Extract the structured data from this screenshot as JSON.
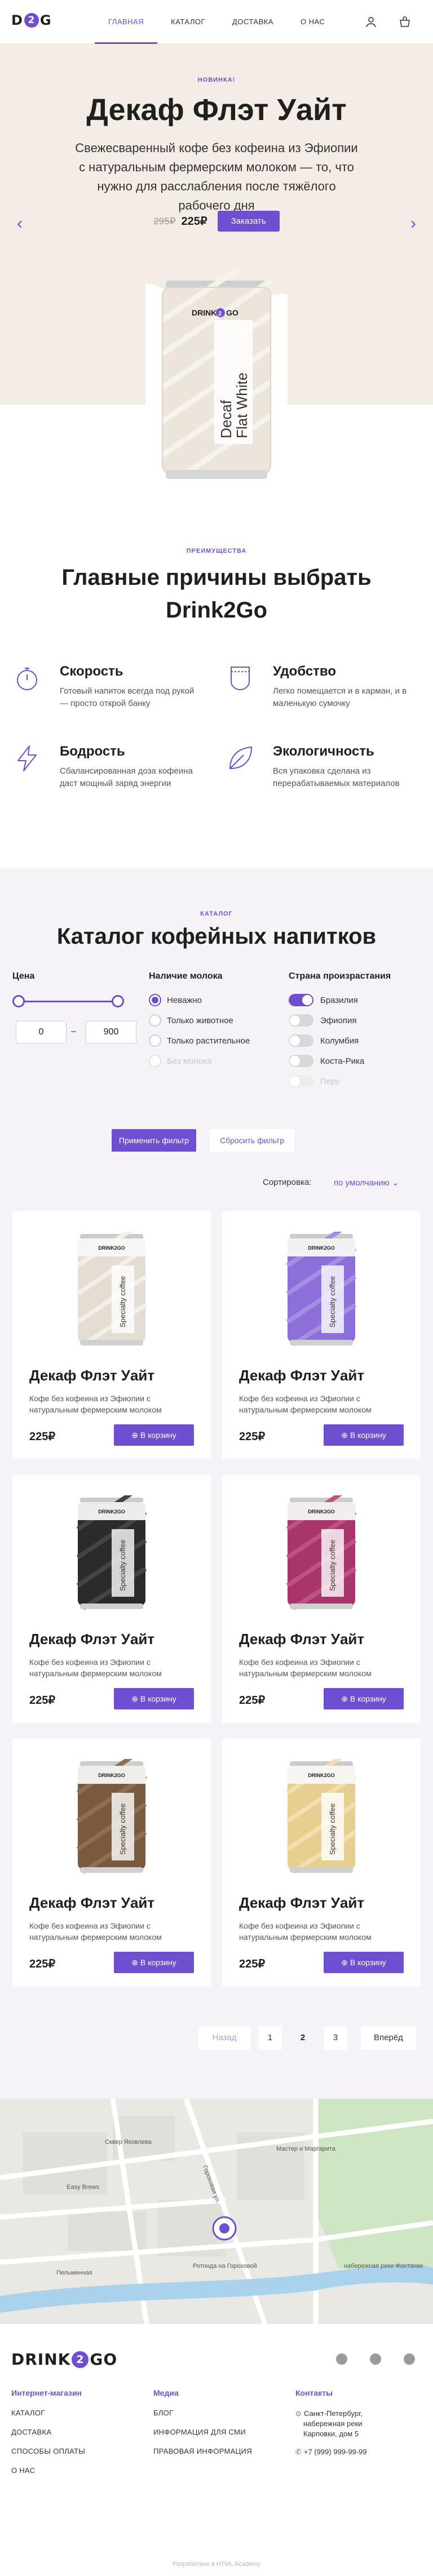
{
  "header": {
    "logo_left": "D",
    "logo_mid": "2",
    "logo_right": "G",
    "nav": [
      "ГЛАВНАЯ",
      "КАТАЛОГ",
      "ДОСТАВКА",
      "О НАС"
    ],
    "icons": [
      "user-icon",
      "cart-icon"
    ]
  },
  "hero": {
    "badge": "НОВИНКА!",
    "title": "Декаф Флэт Уайт",
    "description": "Свежесваренный кофе без кофеина из Эфиопии с натуральным фермерским молоком — то, что нужно для расслабления после тяжёлого рабочего дня",
    "old_price": "295₽",
    "new_price": "225₽",
    "order_label": "Заказать",
    "can_brand": "DRINK",
    "can_brand_2": "2",
    "can_brand_3": "GO",
    "can_text_1": "Decaf",
    "can_text_2": "Flat White"
  },
  "features": {
    "badge": "ПРЕИМУЩЕСТВА",
    "title_line1": "Главные причины выбрать",
    "title_line2": "Drink2Go",
    "items": [
      {
        "title": "Скорость",
        "text": "Готовый напиток всегда под рукой — просто открой банку",
        "icon": "stopwatch-icon"
      },
      {
        "title": "Удобство",
        "text": "Легко помещается и в карман, и в маленькую сумочку",
        "icon": "pocket-icon"
      },
      {
        "title": "Бодрость",
        "text": "Сбалансированная доза кофеина даст мощный заряд энергии",
        "icon": "lightning-icon"
      },
      {
        "title": "Экологичность",
        "text": "Вся упаковка сделана из перерабатываемых материалов",
        "icon": "leaf-icon"
      }
    ]
  },
  "catalog": {
    "badge": "КАТАЛОГ",
    "title": "Каталог кофейных напитков",
    "filters": {
      "price_title": "Цена",
      "price_min": "0",
      "price_max": "900",
      "price_range": [
        0,
        900
      ],
      "milk_title": "Наличие молока",
      "milk_options": [
        {
          "label": "Неважно",
          "checked": true,
          "disabled": false
        },
        {
          "label": "Только животное",
          "checked": false,
          "disabled": false
        },
        {
          "label": "Только растительное",
          "checked": false,
          "disabled": false
        },
        {
          "label": "Без молока",
          "checked": false,
          "disabled": true
        }
      ],
      "country_title": "Страна произрастания",
      "country_options": [
        {
          "label": "Бразилия",
          "on": true,
          "disabled": false
        },
        {
          "label": "Эфиопия",
          "on": false,
          "disabled": false
        },
        {
          "label": "Колумбия",
          "on": false,
          "disabled": false
        },
        {
          "label": "Коста-Рика",
          "on": false,
          "disabled": false
        },
        {
          "label": "Перу",
          "on": false,
          "disabled": true
        }
      ],
      "apply_label": "Применить фильтр",
      "reset_label": "Сбросить фильтр"
    },
    "sort_label": "Сортировка:",
    "sort_value": "по умолчанию",
    "products": [
      {
        "name": "Декаф Флэт Уайт",
        "desc": "Кофе без кофеина из Эфиопии с натуральным фермерским молоком",
        "price": "225₽",
        "cart": "В корзину",
        "color": "#e4ddd3",
        "stripe": "#f3eee7"
      },
      {
        "name": "Декаф Флэт Уайт",
        "desc": "Кофе без кофеина из Эфиопии с натуральным фермерским молоком",
        "price": "225₽",
        "cart": "В корзину",
        "color": "#8c6fd9",
        "stripe": "#a58de2"
      },
      {
        "name": "Декаф Флэт Уайт",
        "desc": "Кофе без кофеина из Эфиопии с натуральным фермерским молоком",
        "price": "225₽",
        "cart": "В корзину",
        "color": "#2b2b2b",
        "stripe": "#444444"
      },
      {
        "name": "Декаф Флэт Уайт",
        "desc": "Кофе без кофеина из Эфиопии с натуральным фермерским молоком",
        "price": "225₽",
        "cart": "В корзину",
        "color": "#a8356b",
        "stripe": "#bd5287"
      },
      {
        "name": "Декаф Флэт Уайт",
        "desc": "Кофе без кофеина из Эфиопии с натуральным фермерским молоком",
        "price": "225₽",
        "cart": "В корзину",
        "color": "#7a5a3f",
        "stripe": "#8f6f53"
      },
      {
        "name": "Декаф Флэт Уайт",
        "desc": "Кофе без кофеина из Эфиопии с натуральным фермерским молоком",
        "price": "225₽",
        "cart": "В корзину",
        "color": "#e7cf92",
        "stripe": "#f0dfb0"
      }
    ],
    "can_brand": "DRINK2GO",
    "can_text": "Specialty coffee",
    "pagination": {
      "prev": "Назад",
      "pages": [
        "1",
        "2",
        "3"
      ],
      "current": "2",
      "next": "Вперёд"
    }
  },
  "map": {
    "labels": [
      "Сквер Яковлева",
      "Easy Brews",
      "Ротонда на Гороховой",
      "Мастер и Маргарита",
      "Пельменная",
      "набережная реки Фонтанки",
      "Гороховая ул."
    ]
  },
  "footer": {
    "logo_left": "DRINK",
    "logo_mid": "2",
    "logo_right": "GO",
    "social": [
      "vk-icon",
      "pinterest-icon",
      "skype-icon"
    ],
    "col1_title": "Интернет-магазин",
    "col1_links": [
      "КАТАЛОГ",
      "ДОСТАВКА",
      "СПОСОБЫ ОПЛАТЫ",
      "О НАС"
    ],
    "col2_title": "Медиа",
    "col2_links": [
      "БЛОГ",
      "ИНФОРМАЦИЯ ДЛЯ СМИ",
      "ПРАВОВАЯ ИНФОРМАЦИЯ"
    ],
    "col3_title": "Контакты",
    "address_1": "Санкт-Петербург,",
    "address_2": "набережная реки",
    "address_3": "Карповки, дом 5",
    "phone": "+7 (999) 999-99-99",
    "credits": "Разработано в HTML Academy"
  },
  "colors": {
    "accent": "#6e4fcf",
    "hero_bg": "#f4ede6",
    "catalog_bg": "#f5f3f8"
  }
}
